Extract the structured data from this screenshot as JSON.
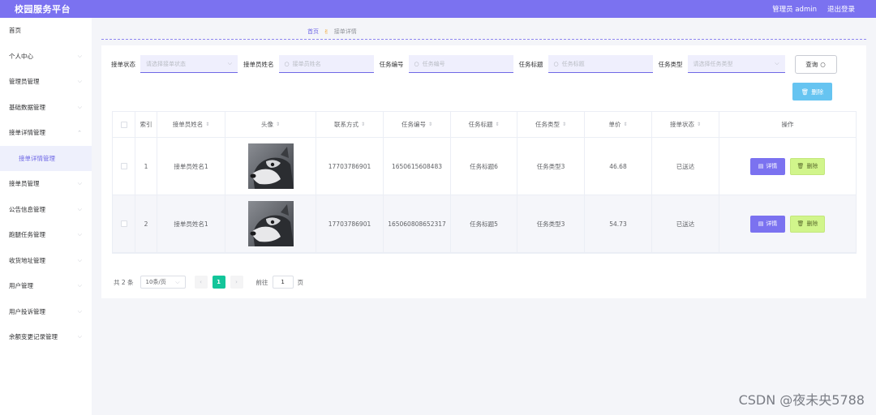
{
  "header": {
    "brand": "校园服务平台",
    "admin": "管理员 admin",
    "logout": "退出登录"
  },
  "sidebar": {
    "items": [
      {
        "label": "首页",
        "chevron": false
      },
      {
        "label": "个人中心",
        "chevron": true
      },
      {
        "label": "管理员管理",
        "chevron": true
      },
      {
        "label": "基础数据管理",
        "chevron": true
      },
      {
        "label": "接单详情管理",
        "chevron": true
      },
      {
        "label": "接单详情管理",
        "sub": true
      },
      {
        "label": "接单员管理",
        "chevron": true
      },
      {
        "label": "公告信息管理",
        "chevron": true
      },
      {
        "label": "跑腿任务管理",
        "chevron": true
      },
      {
        "label": "收货地址管理",
        "chevron": true
      },
      {
        "label": "用户管理",
        "chevron": true
      },
      {
        "label": "用户投诉管理",
        "chevron": true
      },
      {
        "label": "余额变更记录管理",
        "chevron": true
      }
    ]
  },
  "breadcrumb": {
    "home": "首页",
    "separator": "✌",
    "current": "接单详情"
  },
  "search": {
    "status_label": "接单状态",
    "status_placeholder": "请选择接单状态",
    "name_label": "接单员姓名",
    "name_placeholder": "接单员姓名",
    "task_no_label": "任务编号",
    "task_no_placeholder": "任务编号",
    "task_title_label": "任务标题",
    "task_title_placeholder": "任务标题",
    "task_type_label": "任务类型",
    "task_type_placeholder": "请选择任务类型",
    "query_button": "查询"
  },
  "toolbar": {
    "delete_label": "删除"
  },
  "table": {
    "columns": [
      "索引",
      "接单员姓名",
      "头像",
      "联系方式",
      "任务编号",
      "任务标题",
      "任务类型",
      "单价",
      "接单状态",
      "操作"
    ],
    "rows": [
      {
        "index": "1",
        "name": "接单员姓名1",
        "phone": "17703786901",
        "task_no": "1650615608483",
        "title": "任务标题6",
        "type": "任务类型3",
        "price": "46.68",
        "status": "已送达"
      },
      {
        "index": "2",
        "name": "接单员姓名1",
        "phone": "17703786901",
        "task_no": "165060808652317",
        "title": "任务标题5",
        "type": "任务类型3",
        "price": "54.73",
        "status": "已送达"
      }
    ],
    "detail_label": "详情",
    "row_delete_label": "删除"
  },
  "pagination": {
    "total": "共 2 条",
    "page_size": "10条/页",
    "current_page": "1",
    "goto_label": "前往",
    "goto_value": "1",
    "page_suffix": "页"
  },
  "watermark": "CSDN @夜未央5788"
}
